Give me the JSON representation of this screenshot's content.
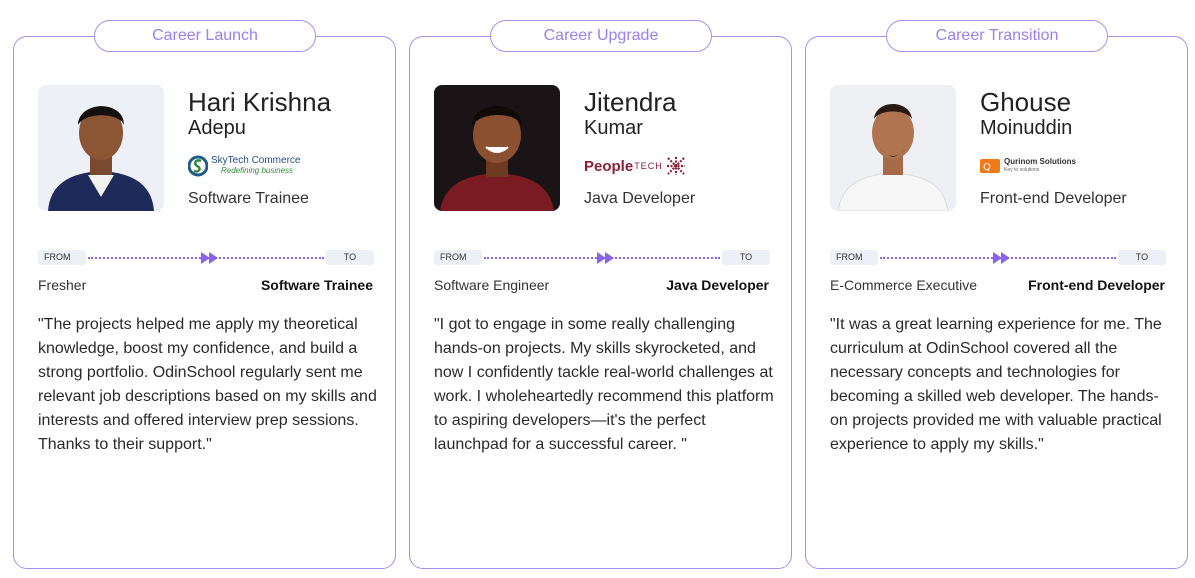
{
  "labels": {
    "from": "FROM",
    "to": "TO"
  },
  "accent": "#a88ef0",
  "cards": [
    {
      "tag": "Career Launch",
      "first_name": "Hari Krishna",
      "last_name": "Adepu",
      "logo": {
        "name": "skytech-logo",
        "title": "SkyTech Commerce",
        "tagline": "Redefining business"
      },
      "role": "Software Trainee",
      "from": "Fresher",
      "to": "Software Trainee",
      "quote": "\"The projects helped me apply my theoretical knowledge, boost my confidence, and build a strong portfolio. OdinSchool regularly sent me relevant job descriptions based on my skills and interests and offered interview prep sessions. Thanks to their support.\""
    },
    {
      "tag": "Career Upgrade",
      "first_name": "Jitendra",
      "last_name": "Kumar",
      "logo": {
        "name": "peopletech-logo",
        "title": "People",
        "tagline": "TECH"
      },
      "role": "Java Developer",
      "from": "Software Engineer",
      "to": "Java Developer",
      "quote": "\"I got to engage in some really challenging hands-on projects. My skills skyrocketed, and now I confidently tackle real-world challenges at work. I wholeheartedly recommend this platform to aspiring developers—it's the perfect launchpad for a successful career. \""
    },
    {
      "tag": "Career Transition",
      "first_name": "Ghouse",
      "last_name": "Moinuddin",
      "logo": {
        "name": "qurinom-logo",
        "title": "Qurinom Solutions",
        "tagline": "Key to solutions"
      },
      "role": "Front-end Developer",
      "from": "E-Commerce Executive",
      "to": "Front-end Developer",
      "quote": "\"It was a great learning experience for me. The curriculum at OdinSchool covered all the necessary concepts and technologies for becoming a skilled web developer. The hands-on projects provided me with valuable practical experience to apply my skills.\""
    }
  ]
}
